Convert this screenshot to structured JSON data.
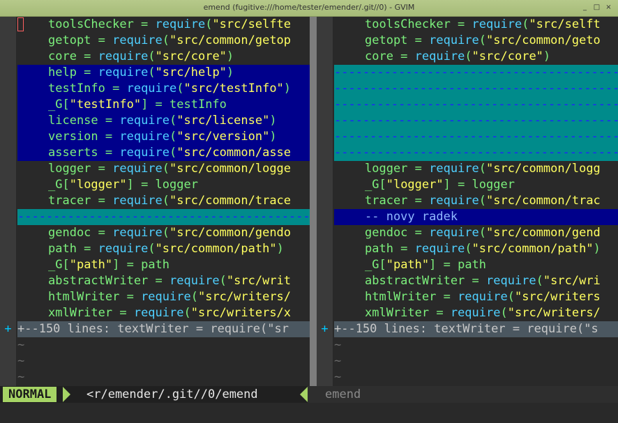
{
  "window": {
    "title": "emend (fugitive:///home/tester/emender/.git//0) - GVIM",
    "controls": [
      "_",
      "□",
      "×"
    ]
  },
  "left_pane": {
    "lines": [
      {
        "kind": "normal",
        "text": "toolsChecker = require(\"src/selfte",
        "cursor": true
      },
      {
        "kind": "normal",
        "text": "getopt = require(\"src/common/getop"
      },
      {
        "kind": "normal",
        "text": "core = require(\"src/core\")"
      },
      {
        "kind": "added",
        "text": "help = require(\"src/help\")"
      },
      {
        "kind": "added",
        "text": "testInfo = require(\"src/testInfo\")"
      },
      {
        "kind": "added",
        "text": "_G[\"testInfo\"] = testInfo"
      },
      {
        "kind": "added",
        "text": "license = require(\"src/license\")"
      },
      {
        "kind": "added",
        "text": "version = require(\"src/version\")"
      },
      {
        "kind": "added",
        "text": "asserts = require(\"src/common/asse"
      },
      {
        "kind": "normal",
        "text": "logger = require(\"src/common/logge"
      },
      {
        "kind": "normal",
        "text": "_G[\"logger\"] = logger"
      },
      {
        "kind": "normal",
        "text": "tracer = require(\"src/common/trace"
      },
      {
        "kind": "filler",
        "text": "----------------------------------------------------"
      },
      {
        "kind": "normal",
        "text": "gendoc = require(\"src/common/gendo"
      },
      {
        "kind": "normal",
        "text": "path = require(\"src/common/path\")"
      },
      {
        "kind": "normal",
        "text": "_G[\"path\"] = path"
      },
      {
        "kind": "normal",
        "text": "abstractWriter = require(\"src/writ"
      },
      {
        "kind": "normal",
        "text": "htmlWriter = require(\"src/writers/"
      },
      {
        "kind": "normal",
        "text": "xmlWriter = require(\"src/writers/x"
      },
      {
        "kind": "fold",
        "gutter": "+",
        "text": "+--150 lines: textWriter = require(\"sr"
      },
      {
        "kind": "tilde",
        "text": "~"
      },
      {
        "kind": "tilde",
        "text": "~"
      },
      {
        "kind": "tilde",
        "text": "~"
      }
    ]
  },
  "right_pane": {
    "lines": [
      {
        "kind": "normal",
        "text": "toolsChecker = require(\"src/selft"
      },
      {
        "kind": "normal",
        "text": "getopt = require(\"src/common/geto"
      },
      {
        "kind": "normal",
        "text": "core = require(\"src/core\")"
      },
      {
        "kind": "filler",
        "text": "----------------------------------------------------"
      },
      {
        "kind": "filler",
        "text": "----------------------------------------------------"
      },
      {
        "kind": "filler",
        "text": "----------------------------------------------------"
      },
      {
        "kind": "filler",
        "text": "----------------------------------------------------"
      },
      {
        "kind": "filler",
        "text": "----------------------------------------------------"
      },
      {
        "kind": "filler",
        "text": "----------------------------------------------------"
      },
      {
        "kind": "normal",
        "text": "logger = require(\"src/common/logg"
      },
      {
        "kind": "normal",
        "text": "_G[\"logger\"] = logger"
      },
      {
        "kind": "normal",
        "text": "tracer = require(\"src/common/trac"
      },
      {
        "kind": "added",
        "text": "-- novy radek"
      },
      {
        "kind": "normal",
        "text": "gendoc = require(\"src/common/gend"
      },
      {
        "kind": "normal",
        "text": "path = require(\"src/common/path\")"
      },
      {
        "kind": "normal",
        "text": "_G[\"path\"] = path"
      },
      {
        "kind": "normal",
        "text": "abstractWriter = require(\"src/wri"
      },
      {
        "kind": "normal",
        "text": "htmlWriter = require(\"src/writers"
      },
      {
        "kind": "normal",
        "text": "xmlWriter = require(\"src/writers/"
      },
      {
        "kind": "fold",
        "gutter": "+",
        "text": "+--150 lines: textWriter = require(\"s"
      },
      {
        "kind": "tilde",
        "text": "~"
      },
      {
        "kind": "tilde",
        "text": "~"
      },
      {
        "kind": "tilde",
        "text": "~"
      }
    ]
  },
  "statusline": {
    "mode": "NORMAL",
    "left_file": "<r/emender/.git//0/emend",
    "right_file": "emend"
  },
  "colors": {
    "added_bg": "#00008b",
    "filler_bg": "#008b8b",
    "fold_bg": "#4b5760",
    "mode_bg": "#a6d465"
  }
}
